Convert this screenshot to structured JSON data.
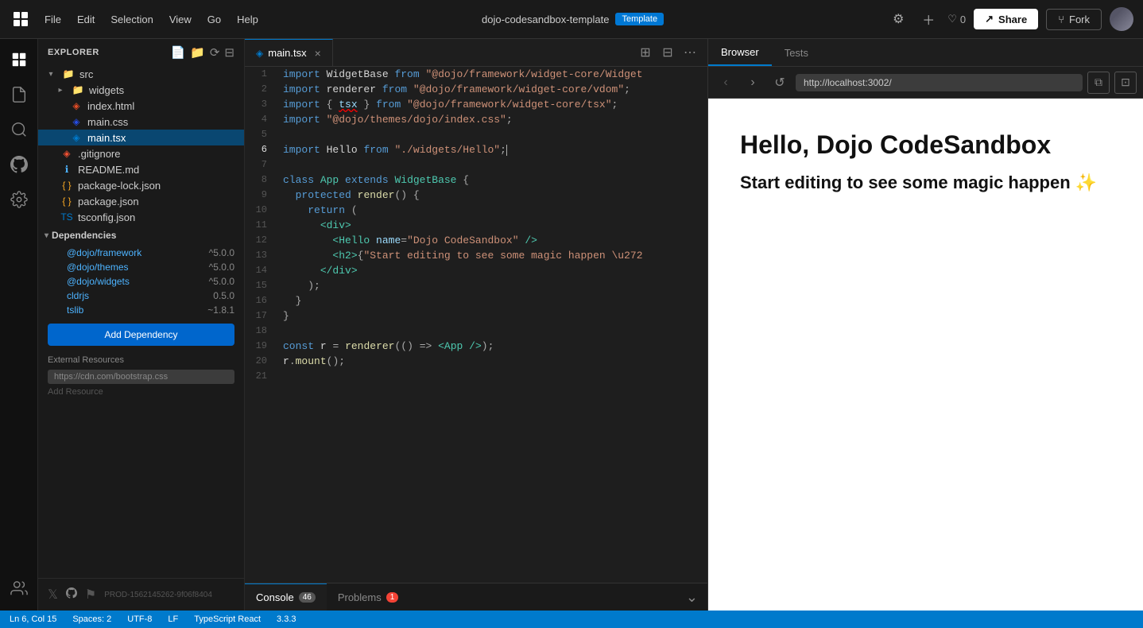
{
  "topbar": {
    "project_name": "dojo-codesandbox-template",
    "template_label": "Template",
    "menu": [
      "File",
      "Edit",
      "Selection",
      "View",
      "Go",
      "Help"
    ],
    "heart_count": "0",
    "share_label": "Share",
    "fork_label": "Fork"
  },
  "sidebar": {
    "title": "EXPLORER",
    "src_folder": "src",
    "widgets_folder": "widgets",
    "files": [
      {
        "name": "index.html",
        "type": "html"
      },
      {
        "name": "main.css",
        "type": "css"
      },
      {
        "name": "main.tsx",
        "type": "tsx",
        "active": true
      },
      {
        "name": ".gitignore",
        "type": "gitignore"
      },
      {
        "name": "README.md",
        "type": "readme"
      },
      {
        "name": "package-lock.json",
        "type": "json"
      },
      {
        "name": "package.json",
        "type": "json"
      },
      {
        "name": "tsconfig.json",
        "type": "ts"
      }
    ],
    "dependencies_label": "Dependencies",
    "deps": [
      {
        "name": "@dojo/framework",
        "version": "^5.0.0"
      },
      {
        "name": "@dojo/themes",
        "version": "^5.0.0"
      },
      {
        "name": "@dojo/widgets",
        "version": "^5.0.0"
      },
      {
        "name": "cldrjs",
        "version": "0.5.0"
      },
      {
        "name": "tslib",
        "version": "~1.8.1"
      }
    ],
    "add_dep_label": "Add Dependency",
    "ext_resources_label": "External Resources",
    "ext_resource_url": "https://cdn.com/bootstrap.css",
    "add_resource_label": "Add Resource",
    "build_id": "PROD-1562145262-9f06f8404"
  },
  "editor": {
    "tab_name": "main.tsx",
    "lines": [
      {
        "num": 1,
        "code": "import WidgetBase from \"@dojo/framework/widget-core/Widget"
      },
      {
        "num": 2,
        "code": "import renderer from \"@dojo/framework/widget-core/vdom\";"
      },
      {
        "num": 3,
        "code": "import { tsx } from \"@dojo/framework/widget-core/tsx\";"
      },
      {
        "num": 4,
        "code": "import \"@dojo/themes/dojo/index.css\";"
      },
      {
        "num": 5,
        "code": ""
      },
      {
        "num": 6,
        "code": "import Hello from \"./widgets/Hello\";"
      },
      {
        "num": 7,
        "code": ""
      },
      {
        "num": 8,
        "code": "class App extends WidgetBase {"
      },
      {
        "num": 9,
        "code": "  protected render() {"
      },
      {
        "num": 10,
        "code": "    return ("
      },
      {
        "num": 11,
        "code": "      <div>"
      },
      {
        "num": 12,
        "code": "        <Hello name=\"Dojo CodeSandbox\" />"
      },
      {
        "num": 13,
        "code": "        <h2>{\"Start editing to see some magic happen \\u272"
      },
      {
        "num": 14,
        "code": "      </div>"
      },
      {
        "num": 15,
        "code": "    );"
      },
      {
        "num": 16,
        "code": "  }"
      },
      {
        "num": 17,
        "code": "}"
      },
      {
        "num": 18,
        "code": ""
      },
      {
        "num": 19,
        "code": "const r = renderer(() => <App />);"
      },
      {
        "num": 20,
        "code": "r.mount();"
      },
      {
        "num": 21,
        "code": ""
      }
    ]
  },
  "browser": {
    "tab_browser": "Browser",
    "tab_tests": "Tests",
    "url": "http://localhost:3002/",
    "preview_title": "Hello, Dojo CodeSandbox",
    "preview_subtitle": "Start editing to see some magic happen ✨"
  },
  "bottom": {
    "console_label": "Console",
    "console_count": "46",
    "problems_label": "Problems",
    "problems_count": "1"
  },
  "statusbar": {
    "line_col": "Ln 6, Col 15",
    "spaces": "Spaces: 2",
    "encoding": "UTF-8",
    "line_ending": "LF",
    "language": "TypeScript React",
    "version": "3.3.3"
  }
}
